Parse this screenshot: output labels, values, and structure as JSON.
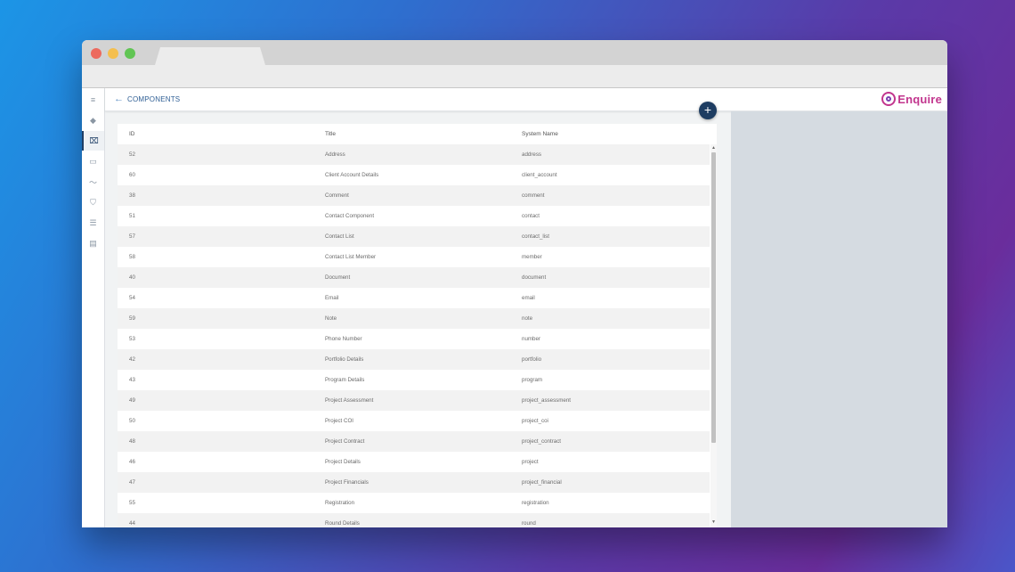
{
  "header": {
    "title": "COMPONENTS",
    "back_icon": "arrow-left-icon"
  },
  "brand": {
    "name": "Enquire",
    "color": "#c2368e"
  },
  "sidebar": {
    "items": [
      {
        "name": "menu",
        "icon": "hamburger-icon",
        "glyph": "≡"
      },
      {
        "name": "layers",
        "icon": "layers-icon",
        "glyph": "◆"
      },
      {
        "name": "components",
        "icon": "components-icon",
        "glyph": "⌧",
        "active": true
      },
      {
        "name": "panel",
        "icon": "panel-icon",
        "glyph": "▭"
      },
      {
        "name": "analytics",
        "icon": "trend-icon",
        "glyph": "〜"
      },
      {
        "name": "security",
        "icon": "shield-icon",
        "glyph": "⛉"
      },
      {
        "name": "list",
        "icon": "list-icon",
        "glyph": "☰"
      },
      {
        "name": "document",
        "icon": "document-icon",
        "glyph": "▤"
      }
    ]
  },
  "add_button": {
    "glyph": "+",
    "icon": "plus-icon"
  },
  "table": {
    "columns": [
      "ID",
      "Title",
      "System Name"
    ],
    "rows": [
      [
        "52",
        "Address",
        "address"
      ],
      [
        "60",
        "Client Account Details",
        "client_account"
      ],
      [
        "38",
        "Comment",
        "comment"
      ],
      [
        "51",
        "Contact Component",
        "contact"
      ],
      [
        "57",
        "Contact List",
        "contact_list"
      ],
      [
        "58",
        "Contact List Member",
        "member"
      ],
      [
        "40",
        "Document",
        "document"
      ],
      [
        "54",
        "Email",
        "email"
      ],
      [
        "59",
        "Note",
        "note"
      ],
      [
        "53",
        "Phone Number",
        "number"
      ],
      [
        "42",
        "Portfolio Details",
        "portfolio"
      ],
      [
        "43",
        "Program Details",
        "program"
      ],
      [
        "49",
        "Project Assessment",
        "project_assessment"
      ],
      [
        "50",
        "Project COI",
        "project_coi"
      ],
      [
        "48",
        "Project Contract",
        "project_contract"
      ],
      [
        "46",
        "Project Details",
        "project"
      ],
      [
        "47",
        "Project Financials",
        "project_financial"
      ],
      [
        "55",
        "Registration",
        "registration"
      ],
      [
        "44",
        "Round Details",
        "round"
      ]
    ]
  }
}
